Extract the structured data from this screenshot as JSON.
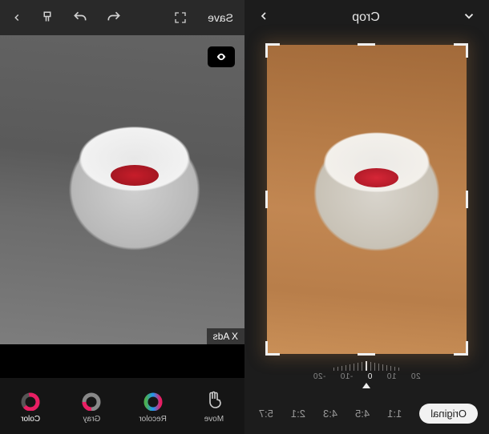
{
  "left": {
    "save_label": "Save",
    "ads_label": "X Ads",
    "tools": [
      {
        "id": "move",
        "label": "Move"
      },
      {
        "id": "recolor",
        "label": "Recolor"
      },
      {
        "id": "gray",
        "label": "Gray"
      },
      {
        "id": "color",
        "label": "Color"
      }
    ],
    "active_tool": "color"
  },
  "right": {
    "title": "Crop",
    "dial": {
      "ticks": [
        "20",
        "10",
        "0",
        "-10",
        "-20"
      ],
      "value": 0
    },
    "ratios": {
      "active": "Original",
      "items": [
        "Original",
        "1:1",
        "4:5",
        "4:3",
        "2:1",
        "5:7"
      ]
    }
  }
}
